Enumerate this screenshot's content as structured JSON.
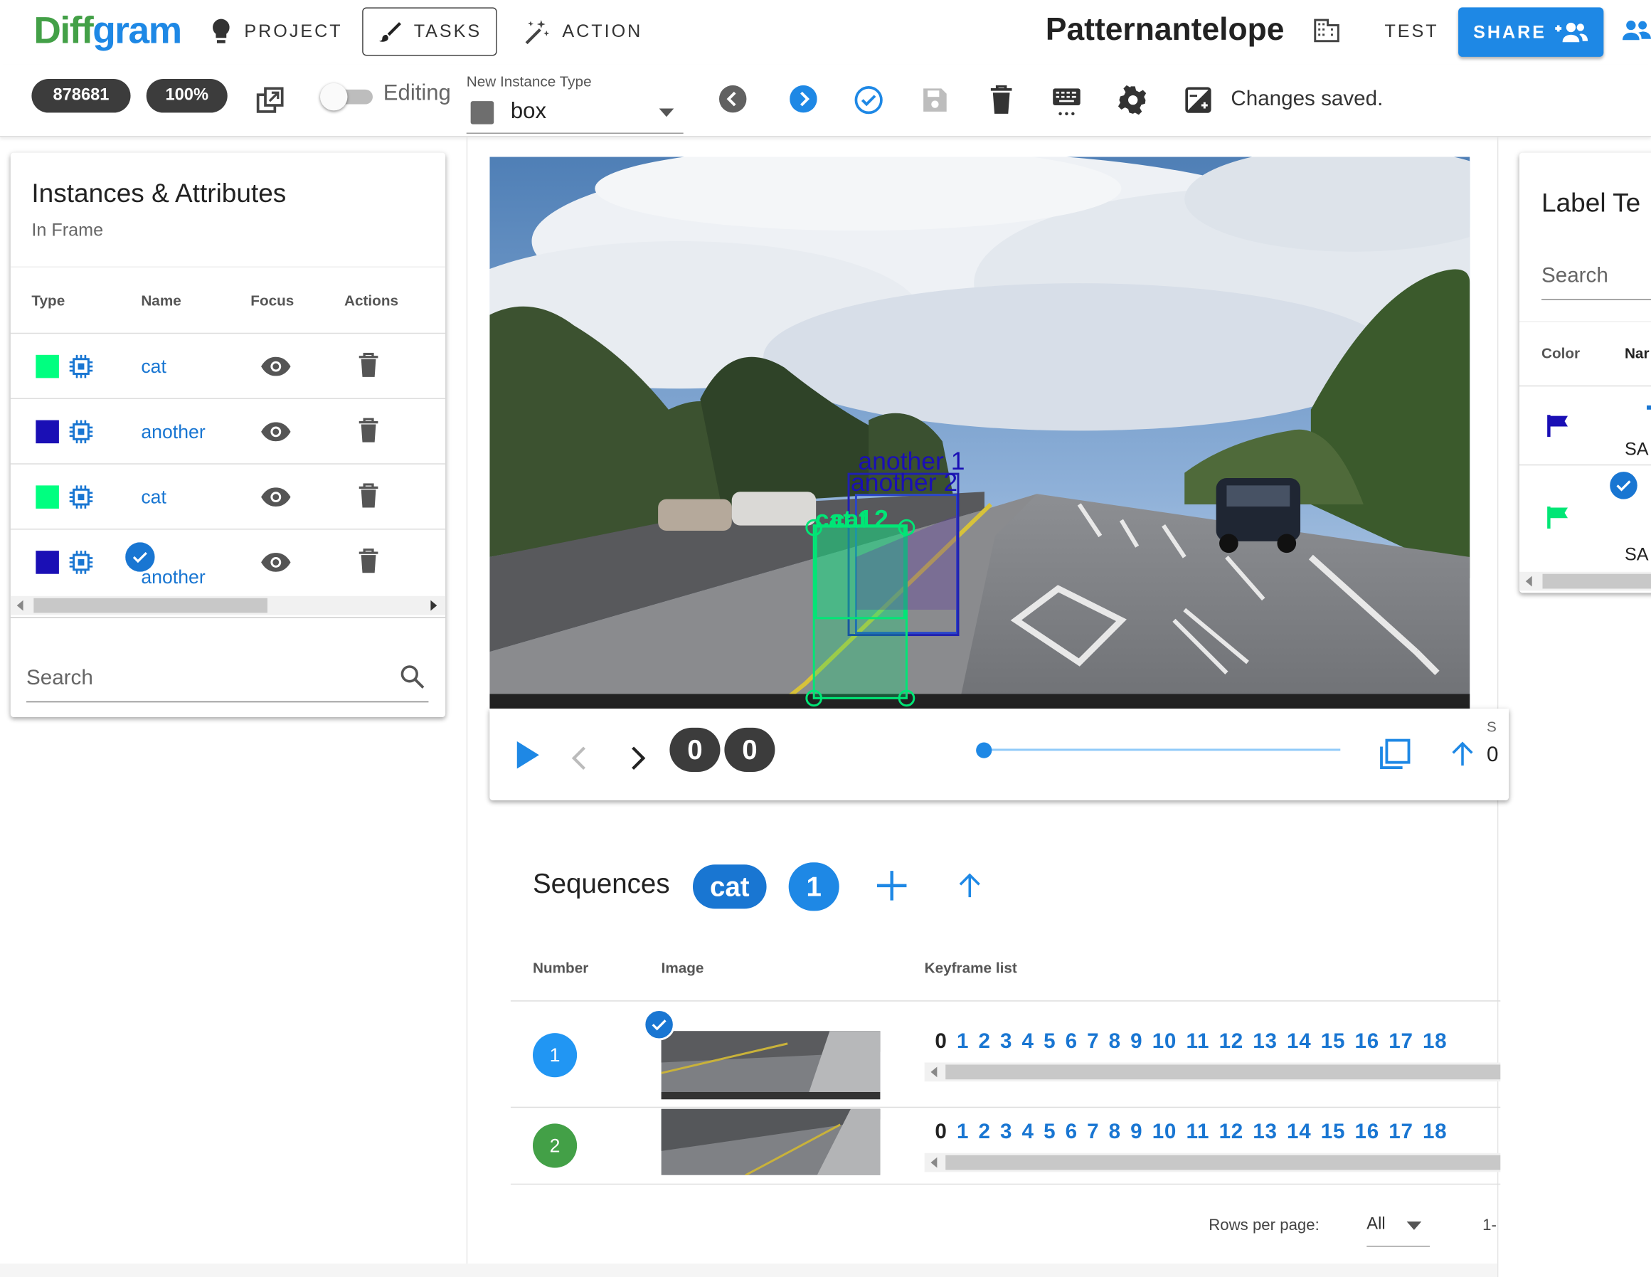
{
  "app": {
    "logo": "Diffgram",
    "project_title": "Patternantelope"
  },
  "nav": {
    "project": "PROJECT",
    "tasks": "TASKS",
    "action": "ACTION",
    "test": "TEST",
    "share": "SHARE"
  },
  "toolbar": {
    "file_id": "878681",
    "zoom": "100%",
    "editing_label": "Editing",
    "instance_type_label": "New Instance Type",
    "instance_type_value": "box",
    "status": "Changes saved."
  },
  "instances": {
    "title": "Instances & Attributes",
    "subtitle": "In Frame",
    "headers": [
      "Type",
      "Name",
      "Focus",
      "Actions"
    ],
    "rows": [
      {
        "color": "#00ff80",
        "name": "cat"
      },
      {
        "color": "#1a0fb5",
        "name": "another"
      },
      {
        "color": "#00ff80",
        "name": "cat"
      },
      {
        "color": "#1a0fb5",
        "name": "another"
      }
    ],
    "search_placeholder": "Search"
  },
  "canvas": {
    "annotations": [
      {
        "text": "another 1"
      },
      {
        "text": "another 2"
      },
      {
        "text": "cat 1"
      },
      {
        "text": "cat 2"
      }
    ]
  },
  "player": {
    "frame_a": "0",
    "frame_b": "0",
    "s_label": "S",
    "s_value": "0"
  },
  "sequences": {
    "title": "Sequences",
    "label_chip": "cat",
    "count_chip": "1",
    "headers": [
      "Number",
      "Image",
      "Keyframe list"
    ],
    "rows": [
      {
        "number": "1",
        "color": "#2196f3",
        "keyframes": [
          "0",
          "1",
          "2",
          "3",
          "4",
          "5",
          "6",
          "7",
          "8",
          "9",
          "10",
          "11",
          "12",
          "13",
          "14",
          "15",
          "16",
          "17",
          "18"
        ]
      },
      {
        "number": "2",
        "color": "#43a047",
        "keyframes": [
          "0",
          "1",
          "2",
          "3",
          "4",
          "5",
          "6",
          "7",
          "8",
          "9",
          "10",
          "11",
          "12",
          "13",
          "14",
          "15",
          "16",
          "17",
          "18"
        ]
      }
    ],
    "rows_per_page_label": "Rows per page:",
    "rows_per_page_value": "All",
    "pagination": "1-"
  },
  "label_panel": {
    "title": "Label Te",
    "search": "Search",
    "headers": [
      "Color",
      "Nar"
    ],
    "rows": [
      {
        "color": "#1a0fb5",
        "text": "SA"
      },
      {
        "color": "#00e676",
        "text": "SA"
      }
    ]
  },
  "colors": {
    "accent": "#1976d2",
    "cat": "#00ff80",
    "another": "#1a0fb5"
  }
}
